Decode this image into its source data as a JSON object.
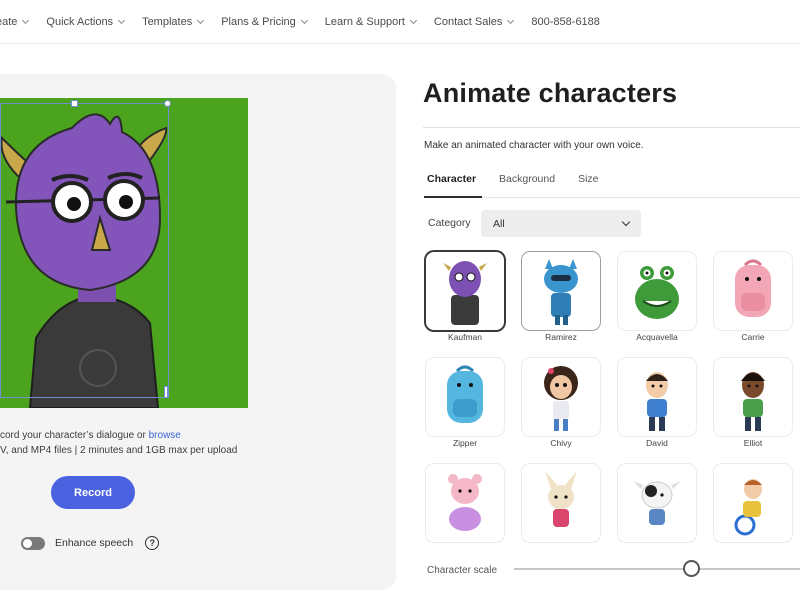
{
  "nav": {
    "items": [
      "eate",
      "Quick Actions",
      "Templates",
      "Plans & Pricing",
      "Learn & Support",
      "Contact Sales"
    ],
    "phone": "800-858-6188"
  },
  "left": {
    "upload_line1_prefix": "cord your character’s dialogue or ",
    "upload_link": "browse",
    "upload_line2": "V, and MP4 files | 2 minutes and 1GB max per upload",
    "record_label": "Record",
    "enhance_label": "Enhance speech",
    "help_glyph": "?"
  },
  "right": {
    "title": "Animate characters",
    "subtitle": "Make an animated character with your own voice.",
    "tabs": [
      "Character",
      "Background",
      "Size"
    ],
    "active_tab": "Character",
    "category_label": "Category",
    "category_value": "All",
    "characters": [
      {
        "name": "Kaufman",
        "icon": "purple-monster-icon"
      },
      {
        "name": "Ramirez",
        "icon": "blue-robot-icon"
      },
      {
        "name": "Acquavella",
        "icon": "green-frog-icon"
      },
      {
        "name": "Carrie",
        "icon": "pink-backpack-icon"
      },
      {
        "name": "Zipper",
        "icon": "blue-backpack-icon"
      },
      {
        "name": "Chivy",
        "icon": "girl-icon"
      },
      {
        "name": "David",
        "icon": "boy-icon"
      },
      {
        "name": "Elliot",
        "icon": "boy-dark-icon"
      },
      {
        "name": "",
        "icon": "pink-bear-icon"
      },
      {
        "name": "",
        "icon": "bunny-icon"
      },
      {
        "name": "",
        "icon": "cow-icon"
      },
      {
        "name": "",
        "icon": "wheelchair-kid-icon"
      }
    ],
    "scale_label": "Character scale",
    "scale_value": 0.62
  },
  "colors": {
    "preview_bg": "#4ca41e",
    "record_button": "#4b62e0",
    "link": "#3b63d6"
  }
}
